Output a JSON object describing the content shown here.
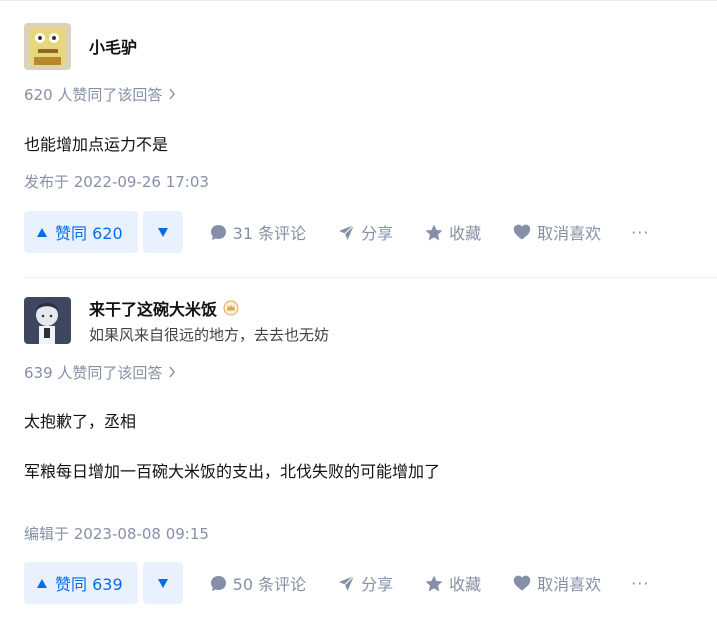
{
  "answers": [
    {
      "author_name": "小毛驴",
      "vote_line": "620 人赞同了该回答",
      "paragraphs": [
        "也能增加点运力不是"
      ],
      "time_label": "发布于 2022-09-26 17:03",
      "vote_label": "赞同 620",
      "comments_label": "31 条评论",
      "share_label": "分享",
      "collect_label": "收藏",
      "like_label": "取消喜欢",
      "more_label": "···"
    },
    {
      "author_name": "来干了这碗大米饭",
      "author_headline": "如果风来自很远的地方，去去也无妨",
      "vote_line": "639 人赞同了该回答",
      "paragraphs": [
        "太抱歉了，丞相",
        "军粮每日增加一百碗大米饭的支出，北伐失败的可能增加了"
      ],
      "time_label": "编辑于 2023-08-08 09:15",
      "vote_label": "赞同 639",
      "comments_label": "50 条评论",
      "share_label": "分享",
      "collect_label": "收藏",
      "like_label": "取消喜欢",
      "more_label": "···"
    }
  ],
  "colors": {
    "accent": "#056de8",
    "vote_bg": "#e8f1fd",
    "meta": "#8590a6",
    "badge": "#e1a94b"
  },
  "icons": [
    "upvote-icon",
    "downvote-icon",
    "comment-icon",
    "share-icon",
    "star-icon",
    "heart-icon",
    "chevron-right-icon",
    "badge-icon"
  ]
}
